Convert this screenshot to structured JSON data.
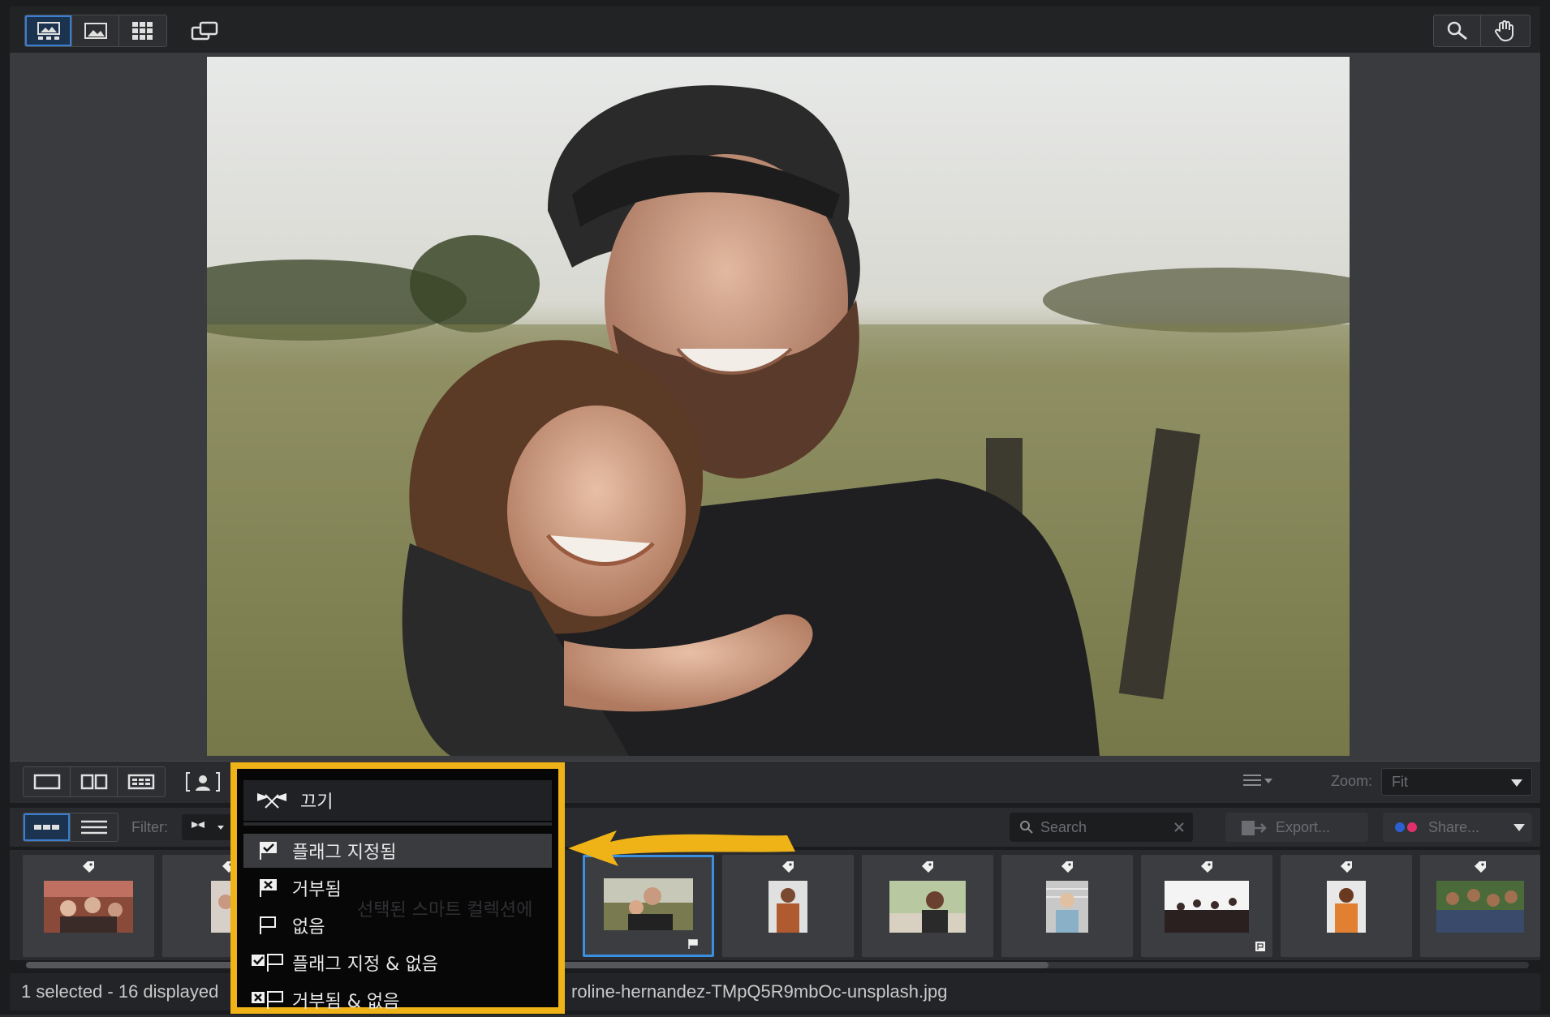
{
  "toolbar_top": {
    "view_buttons": [
      "viewer-mode-icon",
      "single-image-icon",
      "grid-icon"
    ],
    "right_tools": [
      "zoom-tool-icon",
      "hand-tool-icon"
    ]
  },
  "layout_bar": {
    "zoom_label": "Zoom:",
    "zoom_value": "Fit"
  },
  "filter_bar": {
    "filter_label": "Filter:",
    "search_placeholder": "Search",
    "export_label": "Export...",
    "share_label": "Share..."
  },
  "flag_menu": {
    "header": "끄기",
    "items": [
      {
        "label": "플래그 지정됨",
        "icon": "flagged-icon"
      },
      {
        "label": "거부됨",
        "icon": "rejected-icon"
      },
      {
        "label": "없음",
        "icon": "unflagged-icon"
      },
      {
        "label": "플래그 지정 & 없음",
        "icon": "flagged-and-none-icon"
      },
      {
        "label": "거부됨 & 없음",
        "icon": "rejected-and-none-icon"
      }
    ],
    "behind_text": "선택된 스마트 컬렉션에"
  },
  "status": {
    "count": "1 selected - 16 displayed",
    "filename": "roline-hernandez-TMpQ5R9mbOc-unsplash.jpg"
  },
  "colors": {
    "accent": "#f0b317",
    "selection": "#3a8fe0"
  }
}
